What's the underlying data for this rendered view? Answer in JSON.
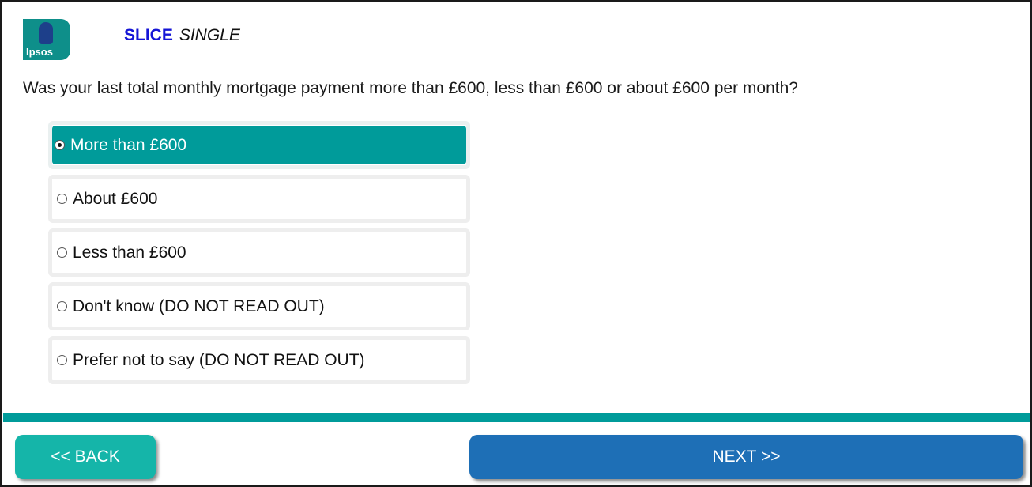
{
  "header": {
    "logo_text": "Ipsos",
    "slice_label": "SLICE",
    "mode_label": "SINGLE"
  },
  "question": {
    "text": "Was your last total monthly mortgage payment more than £600, less than £600 or about £600 per month?"
  },
  "options": [
    {
      "label": "More than £600",
      "selected": true
    },
    {
      "label": "About £600",
      "selected": false
    },
    {
      "label": "Less than £600",
      "selected": false
    },
    {
      "label": "Don't know (DO NOT READ OUT)",
      "selected": false
    },
    {
      "label": "Prefer not to say (DO NOT READ OUT)",
      "selected": false
    }
  ],
  "footer": {
    "back_label": "<< BACK",
    "next_label": "NEXT >>"
  },
  "colors": {
    "accent_teal": "#009b9a",
    "back_button": "#15b5a9",
    "next_button": "#1e6fb6",
    "slice_blue": "#1515d6"
  }
}
